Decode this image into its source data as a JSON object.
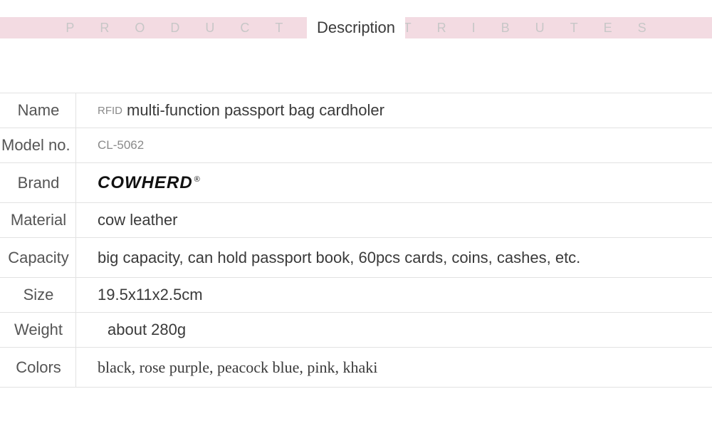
{
  "banner": {
    "spaced_text": "PRODUCT ATTRIBUTES",
    "center": "Description"
  },
  "rows": {
    "name": {
      "label": "Name",
      "prefix": "RFID",
      "value": "multi-function passport bag cardholer"
    },
    "model": {
      "label": "Model no.",
      "value": "CL-5062"
    },
    "brand": {
      "label": "Brand",
      "value": "COWHERD",
      "reg": "®"
    },
    "material": {
      "label": "Material",
      "value": "cow leather"
    },
    "capacity": {
      "label": "Capacity",
      "value": "big capacity, can hold passport book, 60pcs cards, coins, cashes, etc."
    },
    "size": {
      "label": "Size",
      "value": "19.5x11x2.5cm"
    },
    "weight": {
      "label": "Weight",
      "value": "about 280g"
    },
    "colors": {
      "label": "Colors",
      "value": "black, rose purple, peacock blue, pink, khaki"
    }
  }
}
